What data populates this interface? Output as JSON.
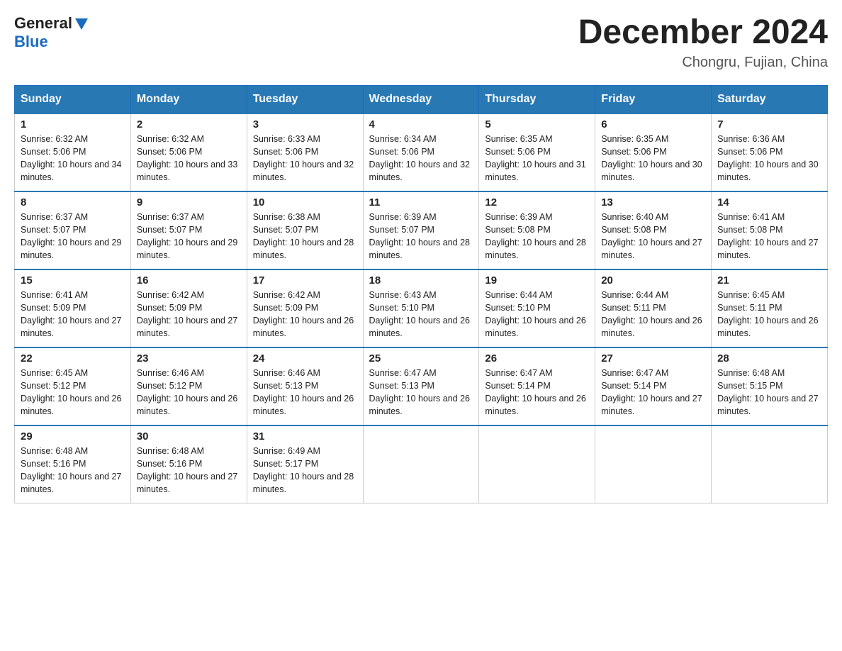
{
  "header": {
    "logo_general": "General",
    "logo_blue": "Blue",
    "title": "December 2024",
    "location": "Chongru, Fujian, China"
  },
  "days_of_week": [
    "Sunday",
    "Monday",
    "Tuesday",
    "Wednesday",
    "Thursday",
    "Friday",
    "Saturday"
  ],
  "weeks": [
    [
      {
        "day": "1",
        "sunrise": "6:32 AM",
        "sunset": "5:06 PM",
        "daylight": "10 hours and 34 minutes."
      },
      {
        "day": "2",
        "sunrise": "6:32 AM",
        "sunset": "5:06 PM",
        "daylight": "10 hours and 33 minutes."
      },
      {
        "day": "3",
        "sunrise": "6:33 AM",
        "sunset": "5:06 PM",
        "daylight": "10 hours and 32 minutes."
      },
      {
        "day": "4",
        "sunrise": "6:34 AM",
        "sunset": "5:06 PM",
        "daylight": "10 hours and 32 minutes."
      },
      {
        "day": "5",
        "sunrise": "6:35 AM",
        "sunset": "5:06 PM",
        "daylight": "10 hours and 31 minutes."
      },
      {
        "day": "6",
        "sunrise": "6:35 AM",
        "sunset": "5:06 PM",
        "daylight": "10 hours and 30 minutes."
      },
      {
        "day": "7",
        "sunrise": "6:36 AM",
        "sunset": "5:06 PM",
        "daylight": "10 hours and 30 minutes."
      }
    ],
    [
      {
        "day": "8",
        "sunrise": "6:37 AM",
        "sunset": "5:07 PM",
        "daylight": "10 hours and 29 minutes."
      },
      {
        "day": "9",
        "sunrise": "6:37 AM",
        "sunset": "5:07 PM",
        "daylight": "10 hours and 29 minutes."
      },
      {
        "day": "10",
        "sunrise": "6:38 AM",
        "sunset": "5:07 PM",
        "daylight": "10 hours and 28 minutes."
      },
      {
        "day": "11",
        "sunrise": "6:39 AM",
        "sunset": "5:07 PM",
        "daylight": "10 hours and 28 minutes."
      },
      {
        "day": "12",
        "sunrise": "6:39 AM",
        "sunset": "5:08 PM",
        "daylight": "10 hours and 28 minutes."
      },
      {
        "day": "13",
        "sunrise": "6:40 AM",
        "sunset": "5:08 PM",
        "daylight": "10 hours and 27 minutes."
      },
      {
        "day": "14",
        "sunrise": "6:41 AM",
        "sunset": "5:08 PM",
        "daylight": "10 hours and 27 minutes."
      }
    ],
    [
      {
        "day": "15",
        "sunrise": "6:41 AM",
        "sunset": "5:09 PM",
        "daylight": "10 hours and 27 minutes."
      },
      {
        "day": "16",
        "sunrise": "6:42 AM",
        "sunset": "5:09 PM",
        "daylight": "10 hours and 27 minutes."
      },
      {
        "day": "17",
        "sunrise": "6:42 AM",
        "sunset": "5:09 PM",
        "daylight": "10 hours and 26 minutes."
      },
      {
        "day": "18",
        "sunrise": "6:43 AM",
        "sunset": "5:10 PM",
        "daylight": "10 hours and 26 minutes."
      },
      {
        "day": "19",
        "sunrise": "6:44 AM",
        "sunset": "5:10 PM",
        "daylight": "10 hours and 26 minutes."
      },
      {
        "day": "20",
        "sunrise": "6:44 AM",
        "sunset": "5:11 PM",
        "daylight": "10 hours and 26 minutes."
      },
      {
        "day": "21",
        "sunrise": "6:45 AM",
        "sunset": "5:11 PM",
        "daylight": "10 hours and 26 minutes."
      }
    ],
    [
      {
        "day": "22",
        "sunrise": "6:45 AM",
        "sunset": "5:12 PM",
        "daylight": "10 hours and 26 minutes."
      },
      {
        "day": "23",
        "sunrise": "6:46 AM",
        "sunset": "5:12 PM",
        "daylight": "10 hours and 26 minutes."
      },
      {
        "day": "24",
        "sunrise": "6:46 AM",
        "sunset": "5:13 PM",
        "daylight": "10 hours and 26 minutes."
      },
      {
        "day": "25",
        "sunrise": "6:47 AM",
        "sunset": "5:13 PM",
        "daylight": "10 hours and 26 minutes."
      },
      {
        "day": "26",
        "sunrise": "6:47 AM",
        "sunset": "5:14 PM",
        "daylight": "10 hours and 26 minutes."
      },
      {
        "day": "27",
        "sunrise": "6:47 AM",
        "sunset": "5:14 PM",
        "daylight": "10 hours and 27 minutes."
      },
      {
        "day": "28",
        "sunrise": "6:48 AM",
        "sunset": "5:15 PM",
        "daylight": "10 hours and 27 minutes."
      }
    ],
    [
      {
        "day": "29",
        "sunrise": "6:48 AM",
        "sunset": "5:16 PM",
        "daylight": "10 hours and 27 minutes."
      },
      {
        "day": "30",
        "sunrise": "6:48 AM",
        "sunset": "5:16 PM",
        "daylight": "10 hours and 27 minutes."
      },
      {
        "day": "31",
        "sunrise": "6:49 AM",
        "sunset": "5:17 PM",
        "daylight": "10 hours and 28 minutes."
      },
      null,
      null,
      null,
      null
    ]
  ]
}
